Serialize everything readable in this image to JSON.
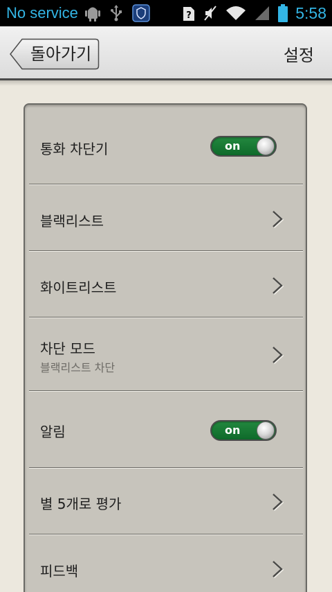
{
  "status_bar": {
    "carrier": "No service",
    "time": "5:58",
    "accent_color": "#33b5e5",
    "icons": [
      "android-debug-icon",
      "usb-icon",
      "shield-icon",
      "sim-unknown-icon",
      "mute-icon",
      "wifi-icon",
      "signal-icon",
      "battery-icon"
    ]
  },
  "header": {
    "back_label": "돌아가기",
    "title": "설정"
  },
  "settings": {
    "items": [
      {
        "label": "통화 차단기",
        "control": "toggle",
        "toggle_text": "on",
        "enabled": true
      },
      {
        "label": "블랙리스트",
        "control": "chevron"
      },
      {
        "label": "화이트리스트",
        "control": "chevron"
      },
      {
        "label": "차단 모드",
        "sublabel": "블랙리스트 차단",
        "control": "chevron"
      },
      {
        "label": "알림",
        "control": "toggle",
        "toggle_text": "on",
        "enabled": true
      },
      {
        "label": "별 5개로 평가",
        "control": "chevron"
      },
      {
        "label": "피드백",
        "control": "chevron"
      }
    ]
  },
  "colors": {
    "toggle_on": "#1a7d36",
    "panel": "#c7c4bc",
    "background": "#ece8de"
  }
}
